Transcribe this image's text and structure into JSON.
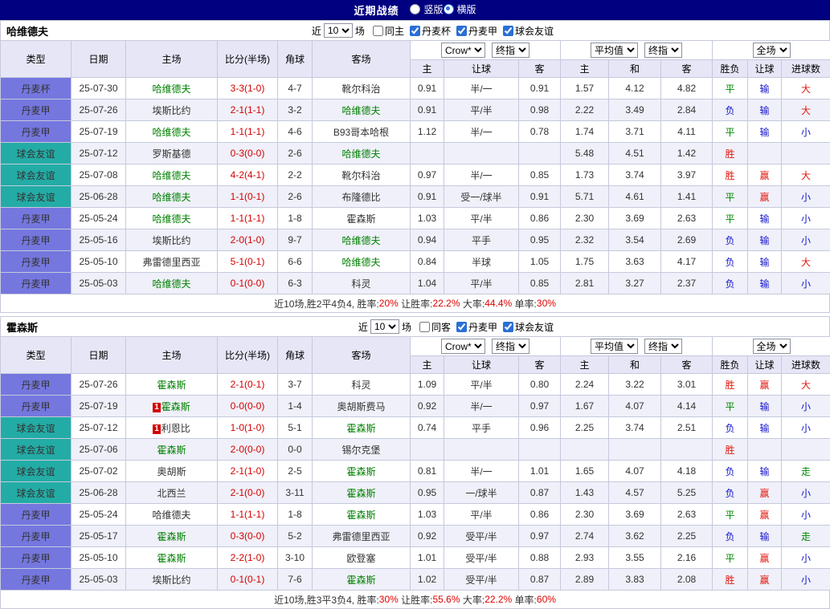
{
  "topbar": {
    "title": "近期战绩",
    "radios": [
      {
        "label": "竖版",
        "selected": false
      },
      {
        "label": "横版",
        "selected": true
      }
    ]
  },
  "colors": {
    "topbar_bg": "#000080",
    "header_bg": "#E6E6F7",
    "row_alt_bg": "#EFF0F9",
    "league_purple": "#7577DF",
    "league_teal": "#23ACA6",
    "focal_team": "#008000",
    "score": "#D40000",
    "win_red": "#E3170D",
    "draw_green": "#008800",
    "loss_blue": "#1515CC",
    "summary_red": "#E00000"
  },
  "league_colors": {
    "丹麦杯": "league_purple",
    "丹麦甲": "league_purple",
    "球会友谊": "league_teal"
  },
  "result_colors": {
    "胜": "win_red",
    "赢": "win_red",
    "大": "win_red",
    "平": "draw_green",
    "走": "draw_green",
    "负": "loss_blue",
    "输": "loss_blue",
    "小": "loss_blue"
  },
  "table_header": {
    "static": [
      "类型",
      "日期",
      "主场",
      "比分(半场)",
      "角球",
      "客场"
    ],
    "odds_group": [
      "Crow*",
      "终指"
    ],
    "avg_group": [
      "平均值",
      "终指"
    ],
    "scope_group": [
      "全场"
    ],
    "sub": [
      "主",
      "让球",
      "客",
      "主",
      "和",
      "客",
      "胜负",
      "让球",
      "进球数"
    ]
  },
  "sections": [
    {
      "team": "哈维德夫",
      "filter": {
        "prefix": "近",
        "count": "10",
        "suffix": "场",
        "checkboxes": [
          {
            "label": "同主",
            "checked": false
          },
          {
            "label": "丹麦杯",
            "checked": true
          },
          {
            "label": "丹麦甲",
            "checked": true
          },
          {
            "label": "球会友谊",
            "checked": true
          }
        ]
      },
      "rows": [
        {
          "league": "丹麦杯",
          "date": "25-07-30",
          "home": "哈维德夫",
          "home_focal": true,
          "score": "3-3(1-0)",
          "corner": "4-7",
          "away": "靴尔科治",
          "odds": [
            "0.91",
            "半/一",
            "0.91"
          ],
          "avg": [
            "1.57",
            "4.12",
            "4.82"
          ],
          "result": [
            "平",
            "输",
            "大"
          ]
        },
        {
          "league": "丹麦甲",
          "date": "25-07-26",
          "home": "埃斯比约",
          "score": "2-1(1-1)",
          "corner": "3-2",
          "away": "哈维德夫",
          "away_focal": true,
          "odds": [
            "0.91",
            "平/半",
            "0.98"
          ],
          "avg": [
            "2.22",
            "3.49",
            "2.84"
          ],
          "result": [
            "负",
            "输",
            "大"
          ]
        },
        {
          "league": "丹麦甲",
          "date": "25-07-19",
          "home": "哈维德夫",
          "home_focal": true,
          "score": "1-1(1-1)",
          "corner": "4-6",
          "away": "B93哥本哈根",
          "odds": [
            "1.12",
            "半/一",
            "0.78"
          ],
          "avg": [
            "1.74",
            "3.71",
            "4.11"
          ],
          "result": [
            "平",
            "输",
            "小"
          ]
        },
        {
          "league": "球会友谊",
          "date": "25-07-12",
          "home": "罗斯基德",
          "score": "0-3(0-0)",
          "corner": "2-6",
          "away": "哈维德夫",
          "away_focal": true,
          "odds": [
            "",
            "",
            ""
          ],
          "avg": [
            "5.48",
            "4.51",
            "1.42"
          ],
          "result": [
            "胜",
            "",
            ""
          ]
        },
        {
          "league": "球会友谊",
          "date": "25-07-08",
          "home": "哈维德夫",
          "home_focal": true,
          "score": "4-2(4-1)",
          "corner": "2-2",
          "away": "靴尔科治",
          "odds": [
            "0.97",
            "半/一",
            "0.85"
          ],
          "avg": [
            "1.73",
            "3.74",
            "3.97"
          ],
          "result": [
            "胜",
            "赢",
            "大"
          ]
        },
        {
          "league": "球会友谊",
          "date": "25-06-28",
          "home": "哈维德夫",
          "home_focal": true,
          "score": "1-1(0-1)",
          "corner": "2-6",
          "away": "布隆德比",
          "odds": [
            "0.91",
            "受一/球半",
            "0.91"
          ],
          "avg": [
            "5.71",
            "4.61",
            "1.41"
          ],
          "result": [
            "平",
            "赢",
            "小"
          ]
        },
        {
          "league": "丹麦甲",
          "date": "25-05-24",
          "home": "哈维德夫",
          "home_focal": true,
          "score": "1-1(1-1)",
          "corner": "1-8",
          "away": "霍森斯",
          "odds": [
            "1.03",
            "平/半",
            "0.86"
          ],
          "avg": [
            "2.30",
            "3.69",
            "2.63"
          ],
          "result": [
            "平",
            "输",
            "小"
          ]
        },
        {
          "league": "丹麦甲",
          "date": "25-05-16",
          "home": "埃斯比约",
          "score": "2-0(1-0)",
          "corner": "9-7",
          "away": "哈维德夫",
          "away_focal": true,
          "odds": [
            "0.94",
            "平手",
            "0.95"
          ],
          "avg": [
            "2.32",
            "3.54",
            "2.69"
          ],
          "result": [
            "负",
            "输",
            "小"
          ]
        },
        {
          "league": "丹麦甲",
          "date": "25-05-10",
          "home": "弗雷德里西亚",
          "score": "5-1(0-1)",
          "corner": "6-6",
          "away": "哈维德夫",
          "away_focal": true,
          "odds": [
            "0.84",
            "半球",
            "1.05"
          ],
          "avg": [
            "1.75",
            "3.63",
            "4.17"
          ],
          "result": [
            "负",
            "输",
            "大"
          ]
        },
        {
          "league": "丹麦甲",
          "date": "25-05-03",
          "home": "哈维德夫",
          "home_focal": true,
          "score": "0-1(0-0)",
          "corner": "6-3",
          "away": "科灵",
          "odds": [
            "1.04",
            "平/半",
            "0.85"
          ],
          "avg": [
            "2.81",
            "3.27",
            "2.37"
          ],
          "result": [
            "负",
            "输",
            "小"
          ]
        }
      ],
      "summary": [
        {
          "t": "近10场,胜2平4负4, ",
          "c": "k"
        },
        {
          "t": "胜率:",
          "c": "k"
        },
        {
          "t": "20%",
          "c": "r"
        },
        {
          "t": " 让胜率:",
          "c": "k"
        },
        {
          "t": "22.2%",
          "c": "r"
        },
        {
          "t": " 大率:",
          "c": "k"
        },
        {
          "t": "44.4%",
          "c": "r"
        },
        {
          "t": " 单率:",
          "c": "k"
        },
        {
          "t": "30%",
          "c": "r"
        }
      ]
    },
    {
      "team": "霍森斯",
      "filter": {
        "prefix": "近",
        "count": "10",
        "suffix": "场",
        "checkboxes": [
          {
            "label": "同客",
            "checked": false
          },
          {
            "label": "丹麦甲",
            "checked": true
          },
          {
            "label": "球会友谊",
            "checked": true
          }
        ]
      },
      "rows": [
        {
          "league": "丹麦甲",
          "date": "25-07-26",
          "home": "霍森斯",
          "home_focal": true,
          "score": "2-1(0-1)",
          "corner": "3-7",
          "away": "科灵",
          "odds": [
            "1.09",
            "平/半",
            "0.80"
          ],
          "avg": [
            "2.24",
            "3.22",
            "3.01"
          ],
          "result": [
            "胜",
            "赢",
            "大"
          ]
        },
        {
          "league": "丹麦甲",
          "date": "25-07-19",
          "home": "霍森斯",
          "home_focal": true,
          "home_badge": "1",
          "score": "0-0(0-0)",
          "corner": "1-4",
          "away": "奥胡斯费马",
          "odds": [
            "0.92",
            "半/一",
            "0.97"
          ],
          "avg": [
            "1.67",
            "4.07",
            "4.14"
          ],
          "result": [
            "平",
            "输",
            "小"
          ]
        },
        {
          "league": "球会友谊",
          "date": "25-07-12",
          "home": "利恩比",
          "home_badge": "1",
          "score": "1-0(1-0)",
          "corner": "5-1",
          "away": "霍森斯",
          "away_focal": true,
          "odds": [
            "0.74",
            "平手",
            "0.96"
          ],
          "avg": [
            "2.25",
            "3.74",
            "2.51"
          ],
          "result": [
            "负",
            "输",
            "小"
          ]
        },
        {
          "league": "球会友谊",
          "date": "25-07-06",
          "home": "霍森斯",
          "home_focal": true,
          "score": "2-0(0-0)",
          "corner": "0-0",
          "away": "锡尔克堡",
          "odds": [
            "",
            "",
            ""
          ],
          "avg": [
            "",
            "",
            ""
          ],
          "result": [
            "胜",
            "",
            ""
          ]
        },
        {
          "league": "球会友谊",
          "date": "25-07-02",
          "home": "奥胡斯",
          "score": "2-1(1-0)",
          "corner": "2-5",
          "away": "霍森斯",
          "away_focal": true,
          "odds": [
            "0.81",
            "半/一",
            "1.01"
          ],
          "avg": [
            "1.65",
            "4.07",
            "4.18"
          ],
          "result": [
            "负",
            "输",
            "走"
          ]
        },
        {
          "league": "球会友谊",
          "date": "25-06-28",
          "home": "北西兰",
          "score": "2-1(0-0)",
          "corner": "3-11",
          "away": "霍森斯",
          "away_focal": true,
          "odds": [
            "0.95",
            "一/球半",
            "0.87"
          ],
          "avg": [
            "1.43",
            "4.57",
            "5.25"
          ],
          "result": [
            "负",
            "赢",
            "小"
          ]
        },
        {
          "league": "丹麦甲",
          "date": "25-05-24",
          "home": "哈维德夫",
          "score": "1-1(1-1)",
          "corner": "1-8",
          "away": "霍森斯",
          "away_focal": true,
          "odds": [
            "1.03",
            "平/半",
            "0.86"
          ],
          "avg": [
            "2.30",
            "3.69",
            "2.63"
          ],
          "result": [
            "平",
            "赢",
            "小"
          ]
        },
        {
          "league": "丹麦甲",
          "date": "25-05-17",
          "home": "霍森斯",
          "home_focal": true,
          "score": "0-3(0-0)",
          "corner": "5-2",
          "away": "弗雷德里西亚",
          "odds": [
            "0.92",
            "受平/半",
            "0.97"
          ],
          "avg": [
            "2.74",
            "3.62",
            "2.25"
          ],
          "result": [
            "负",
            "输",
            "走"
          ]
        },
        {
          "league": "丹麦甲",
          "date": "25-05-10",
          "home": "霍森斯",
          "home_focal": true,
          "score": "2-2(1-0)",
          "corner": "3-10",
          "away": "欧登塞",
          "odds": [
            "1.01",
            "受平/半",
            "0.88"
          ],
          "avg": [
            "2.93",
            "3.55",
            "2.16"
          ],
          "result": [
            "平",
            "赢",
            "小"
          ]
        },
        {
          "league": "丹麦甲",
          "date": "25-05-03",
          "home": "埃斯比约",
          "score": "0-1(0-1)",
          "corner": "7-6",
          "away": "霍森斯",
          "away_focal": true,
          "odds": [
            "1.02",
            "受平/半",
            "0.87"
          ],
          "avg": [
            "2.89",
            "3.83",
            "2.08"
          ],
          "result": [
            "胜",
            "赢",
            "小"
          ]
        }
      ],
      "summary": [
        {
          "t": "近10场,胜3平3负4, ",
          "c": "k"
        },
        {
          "t": "胜率:",
          "c": "k"
        },
        {
          "t": "30%",
          "c": "r"
        },
        {
          "t": " 让胜率:",
          "c": "k"
        },
        {
          "t": "55.6%",
          "c": "r"
        },
        {
          "t": " 大率:",
          "c": "k"
        },
        {
          "t": "22.2%",
          "c": "r"
        },
        {
          "t": " 单率:",
          "c": "k"
        },
        {
          "t": "60%",
          "c": "r"
        }
      ]
    }
  ]
}
